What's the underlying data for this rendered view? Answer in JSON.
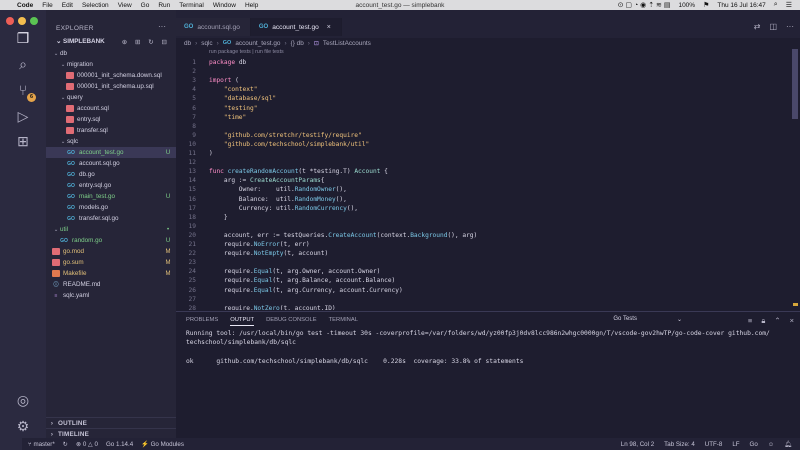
{
  "menubar": {
    "app": "Code",
    "items": [
      "File",
      "Edit",
      "Selection",
      "View",
      "Go",
      "Run",
      "Terminal",
      "Window",
      "Help"
    ],
    "window_title": "account_test.go — simplebank",
    "battery": "100%",
    "clock": "Thu 16 Jul 16:47"
  },
  "colors": {
    "accent": "#4fb0d7",
    "background": "#1e1d2f",
    "traffic_red": "#ee5f57",
    "traffic_yellow": "#f4be4f",
    "traffic_green": "#5bc453"
  },
  "activity": {
    "scm_badge": "6"
  },
  "sidebar": {
    "title": "EXPLORER",
    "project": "SIMPLEBANK",
    "tree": [
      {
        "label": "db",
        "type": "folder",
        "indent": 0
      },
      {
        "label": "migration",
        "type": "folder",
        "indent": 1
      },
      {
        "label": "000001_init_schema.down.sql",
        "type": "sql",
        "indent": 2
      },
      {
        "label": "000001_init_schema.up.sql",
        "type": "sql",
        "indent": 2
      },
      {
        "label": "query",
        "type": "folder",
        "indent": 1
      },
      {
        "label": "account.sql",
        "type": "sql",
        "indent": 2
      },
      {
        "label": "entry.sql",
        "type": "sql",
        "indent": 2
      },
      {
        "label": "transfer.sql",
        "type": "sql",
        "indent": 2
      },
      {
        "label": "sqlc",
        "type": "folder",
        "indent": 1
      },
      {
        "label": "account_test.go",
        "type": "go",
        "indent": 2,
        "badge": "U",
        "selected": true
      },
      {
        "label": "account.sql.go",
        "type": "go",
        "indent": 2
      },
      {
        "label": "db.go",
        "type": "go",
        "indent": 2
      },
      {
        "label": "entry.sql.go",
        "type": "go",
        "indent": 2
      },
      {
        "label": "main_test.go",
        "type": "go",
        "indent": 2,
        "badge": "U"
      },
      {
        "label": "models.go",
        "type": "go",
        "indent": 2
      },
      {
        "label": "transfer.sql.go",
        "type": "go",
        "indent": 2
      },
      {
        "label": "util",
        "type": "folder",
        "indent": 0,
        "badge": "•"
      },
      {
        "label": "random.go",
        "type": "go",
        "indent": 1,
        "badge": "U"
      },
      {
        "label": "go.mod",
        "type": "mod",
        "indent": 0,
        "badge": "M"
      },
      {
        "label": "go.sum",
        "type": "mod",
        "indent": 0,
        "badge": "M"
      },
      {
        "label": "Makefile",
        "type": "make",
        "indent": 0,
        "badge": "M"
      },
      {
        "label": "README.md",
        "type": "md",
        "indent": 0
      },
      {
        "label": "sqlc.yaml",
        "type": "yaml",
        "indent": 0
      }
    ],
    "outline": "OUTLINE",
    "timeline": "TIMELINE"
  },
  "tabs": [
    {
      "label": "account.sql.go",
      "active": false
    },
    {
      "label": "account_test.go",
      "active": true,
      "close": "×"
    }
  ],
  "breadcrumb": [
    "db",
    "sqlc",
    "account_test.go",
    "{} db",
    "TestListAccounts"
  ],
  "codelens": "run package tests | run file tests",
  "code": [
    {
      "n": "1",
      "html": "<span class=\"k\">package</span> <span class=\"p\">db</span>"
    },
    {
      "n": "2",
      "html": ""
    },
    {
      "n": "3",
      "html": "<span class=\"k\">import</span> ("
    },
    {
      "n": "4",
      "html": "    <span class=\"s\">\"context\"</span>"
    },
    {
      "n": "5",
      "html": "    <span class=\"s\">\"database/sql\"</span>"
    },
    {
      "n": "6",
      "html": "    <span class=\"s\">\"testing\"</span>"
    },
    {
      "n": "7",
      "html": "    <span class=\"s\">\"time\"</span>"
    },
    {
      "n": "8",
      "html": ""
    },
    {
      "n": "9",
      "html": "    <span class=\"s\">\"github.com/stretchr/testify/require\"</span>"
    },
    {
      "n": "10",
      "html": "    <span class=\"s\">\"github.com/techschool/simplebank/util\"</span>"
    },
    {
      "n": "11",
      "html": ")"
    },
    {
      "n": "12",
      "html": ""
    },
    {
      "n": "13",
      "html": "<span class=\"k\">func</span> <span class=\"f\">createRandomAccount</span>(t *testing.T) <span class=\"t\">Account</span> {"
    },
    {
      "n": "14",
      "html": "    arg := <span class=\"t\">CreateAccountParams</span>{"
    },
    {
      "n": "15",
      "html": "        Owner:    util.<span class=\"f\">RandomOwner</span>(),"
    },
    {
      "n": "16",
      "html": "        Balance:  util.<span class=\"f\">RandomMoney</span>(),"
    },
    {
      "n": "17",
      "html": "        Currency: util.<span class=\"f\">RandomCurrency</span>(),"
    },
    {
      "n": "18",
      "html": "    }"
    },
    {
      "n": "19",
      "html": ""
    },
    {
      "n": "20",
      "html": "    account, err := testQueries.<span class=\"f\">CreateAccount</span>(context.<span class=\"f\">Background</span>(), arg)"
    },
    {
      "n": "21",
      "html": "    require.<span class=\"f\">NoError</span>(t, err)"
    },
    {
      "n": "22",
      "html": "    require.<span class=\"f\">NotEmpty</span>(t, account)"
    },
    {
      "n": "23",
      "html": ""
    },
    {
      "n": "24",
      "html": "    require.<span class=\"f\">Equal</span>(t, arg.Owner, account.Owner)"
    },
    {
      "n": "25",
      "html": "    require.<span class=\"f\">Equal</span>(t, arg.Balance, account.Balance)"
    },
    {
      "n": "26",
      "html": "    require.<span class=\"f\">Equal</span>(t, arg.Currency, account.Currency)"
    },
    {
      "n": "27",
      "html": ""
    },
    {
      "n": "28",
      "html": "    require.<span class=\"f\">NotZero</span>(t, account.ID)"
    }
  ],
  "panel": {
    "tabs": [
      "PROBLEMS",
      "OUTPUT",
      "DEBUG CONSOLE",
      "TERMINAL"
    ],
    "active_tab": "OUTPUT",
    "channel": "Go Tests",
    "output": "Running tool: /usr/local/bin/go test -timeout 30s -coverprofile=/var/folders/wd/yz00fp3j0dv8lcc986n2whgc0000gn/T/vscode-gov2hwTP/go-code-cover github.com/\ntechschool/simplebank/db/sqlc\n\nok      github.com/techschool/simplebank/db/sqlc    0.228s  coverage: 33.8% of statements"
  },
  "status": {
    "branch": "master*",
    "errors": "0",
    "warnings": "0",
    "go_version": "Go 1.14.4",
    "modules": "Go Modules",
    "cursor": "Ln 98, Col 2",
    "tab_size": "Tab Size: 4",
    "encoding": "UTF-8",
    "eol": "LF",
    "language": "Go"
  }
}
